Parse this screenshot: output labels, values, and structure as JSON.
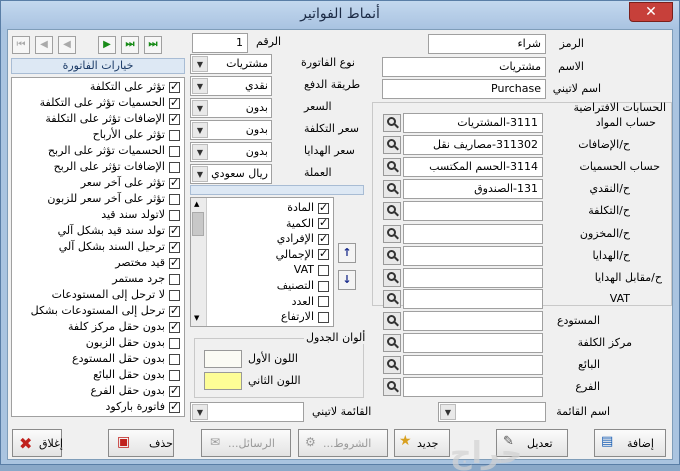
{
  "window": {
    "title": "أنماط الفواتير",
    "close": "✕"
  },
  "form": {
    "code_label": "الرمز",
    "code_value": "شراء",
    "name_label": "الاسم",
    "name_value": "مشتريات",
    "latin_name_label": "اسم لاتيني",
    "latin_name_value": "Purchase",
    "number_label": "الرقم",
    "number_value": "1"
  },
  "invoice_settings": [
    {
      "label": "نوع الفاتورة",
      "value": "مشتريات"
    },
    {
      "label": "طريقة الدفع",
      "value": "نقدي"
    },
    {
      "label": "السعر",
      "value": "بدون"
    },
    {
      "label": "سعر التكلفة",
      "value": "بدون"
    },
    {
      "label": "سعر الهدايا",
      "value": "بدون"
    },
    {
      "label": "العملة",
      "value": "ريال سعودي"
    }
  ],
  "default_accounts": {
    "title": "الحسابات الافتراضية",
    "rows": [
      {
        "label": "حساب المواد",
        "value": "3111-المشتريات"
      },
      {
        "label": "ح/الإضافات",
        "value": "311302-مصاريف نقل"
      },
      {
        "label": "حساب الحسميات",
        "value": "3114-الحسم المكتسب"
      },
      {
        "label": "ح/النقدي",
        "value": "131-الصندوق"
      },
      {
        "label": "ح/التكلفة",
        "value": ""
      },
      {
        "label": "ح/المخزون",
        "value": ""
      },
      {
        "label": "ح/الهدايا",
        "value": ""
      },
      {
        "label": "ح/مقابل الهدايا",
        "value": ""
      },
      {
        "label": "VAT",
        "value": ""
      }
    ]
  },
  "lower_fields": [
    {
      "label": "المستودع",
      "value": ""
    },
    {
      "label": "مركز الكلفة",
      "value": ""
    },
    {
      "label": "البائع",
      "value": ""
    },
    {
      "label": "الفرع",
      "value": ""
    }
  ],
  "list_name": {
    "label": "اسم القائمة",
    "value": ""
  },
  "latin_list": {
    "label": "القائمة لاتيني",
    "value": ""
  },
  "options_panel": {
    "title": "خيارات الفاتورة",
    "items": [
      {
        "label": "تؤثر على التكلفة",
        "checked": true
      },
      {
        "label": "الحسميات تؤثر على التكلفة",
        "checked": true
      },
      {
        "label": "الإضافات تؤثر على التكلفة",
        "checked": true
      },
      {
        "label": "تؤثر على الأرباح",
        "checked": false
      },
      {
        "label": "الحسميات تؤثر على الربح",
        "checked": false
      },
      {
        "label": "الإضافات تؤثر على الربح",
        "checked": false
      },
      {
        "label": "تؤثر على آخر سعر",
        "checked": true
      },
      {
        "label": "تؤثر على آخر سعر للزبون",
        "checked": false
      },
      {
        "label": "لاتولد سند قيد",
        "checked": false
      },
      {
        "label": "تولد سند قيد بشكل آلي",
        "checked": true
      },
      {
        "label": "ترحيل السند بشكل آلي",
        "checked": true
      },
      {
        "label": "قيد مختصر",
        "checked": true
      },
      {
        "label": "جرد مستمر",
        "checked": false
      },
      {
        "label": "لا ترحل إلى المستودعات",
        "checked": false
      },
      {
        "label": "ترحل إلى المستودعات بشكل",
        "checked": true
      },
      {
        "label": "بدون حقل مركز كلفة",
        "checked": true
      },
      {
        "label": "بدون حقل الزبون",
        "checked": false
      },
      {
        "label": "بدون حقل المستودع",
        "checked": false
      },
      {
        "label": "بدون حقل البائع",
        "checked": false
      },
      {
        "label": "بدون حقل الفرع",
        "checked": true
      },
      {
        "label": "فاتورة باركود",
        "checked": true
      }
    ]
  },
  "columns_list": {
    "items": [
      {
        "label": "المادة",
        "checked": true
      },
      {
        "label": "الكمية",
        "checked": true
      },
      {
        "label": "الإفرادي",
        "checked": true
      },
      {
        "label": "الإجمالي",
        "checked": true
      },
      {
        "label": "VAT",
        "checked": false
      },
      {
        "label": "التصنيف",
        "checked": false
      },
      {
        "label": "العدد",
        "checked": false
      },
      {
        "label": "الارتفاع",
        "checked": false
      }
    ],
    "up": "↑",
    "down": "↓"
  },
  "table_colors": {
    "title": "ألوان الجدول",
    "first_label": "اللون الأول",
    "first_color": "#fbfbf4",
    "second_label": "اللون الثاني",
    "second_color": "#fdfd96"
  },
  "nav": {
    "first": "⏮",
    "prev": "◀",
    "play": "▶",
    "next": "⏭",
    "last": "⏭"
  },
  "buttons": {
    "close": "إغلاق",
    "delete": "حذف",
    "messages": "الرسائل...",
    "conditions": "الشروط...",
    "new": "جديد",
    "edit": "تعديل",
    "add": "إضافة"
  },
  "watermark": "حراج"
}
